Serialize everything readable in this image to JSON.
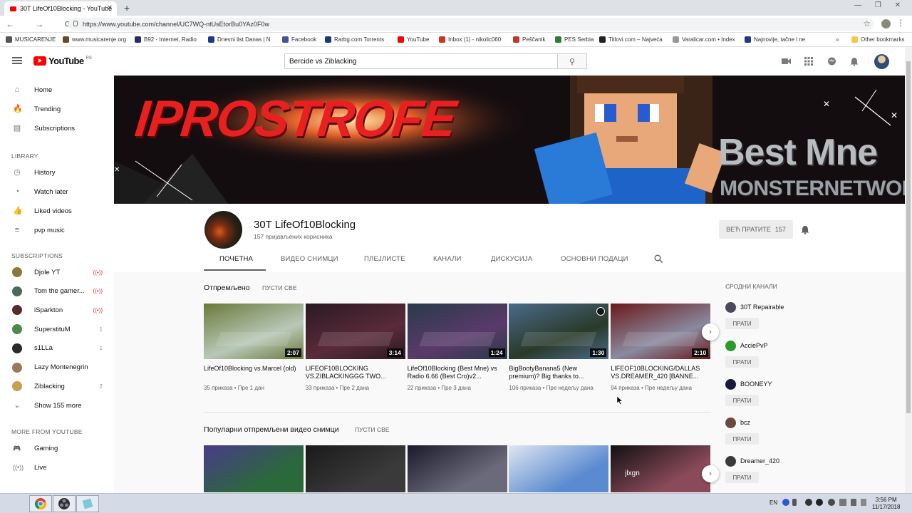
{
  "browser": {
    "tab_title": "30T LifeOf10Blocking - YouTube",
    "tab_close": "✕",
    "new_tab": "+",
    "window_controls": "— ❐ ✕",
    "nav": "← → ⟳ ⌂",
    "url": "https://www.youtube.com/channel/UC7WQ-ntUsEtorBu0YAz0F0w",
    "star": "☆",
    "menu": "⋮",
    "bookmarks": [
      {
        "label": "MUSICARENJE",
        "color": "#555555"
      },
      {
        "label": "www.musicarenje.org",
        "color": "#6b4a2a"
      },
      {
        "label": "B92 - Internet, Radio",
        "color": "#2a2a6b"
      },
      {
        "label": "Dnevni list Danas | N",
        "color": "#1a3a8a"
      },
      {
        "label": "Facebook",
        "color": "#3b5998"
      },
      {
        "label": "Rarbg.com Torrents",
        "color": "#1a3a7a"
      },
      {
        "label": "YouTube",
        "color": "#ff0000"
      },
      {
        "label": "Inbox (1) - nikolic060",
        "color": "#d93025"
      },
      {
        "label": "Peščanik",
        "color": "#c0392b"
      },
      {
        "label": "PES Serbia",
        "color": "#2e7d32"
      },
      {
        "label": "Titlovi.com – Najveća",
        "color": "#222222"
      },
      {
        "label": "Varalicar.com • Index",
        "color": "#999999"
      },
      {
        "label": "Najnovije, tačne i ne",
        "color": "#1b3a8a"
      }
    ],
    "bookmarks_more": "»",
    "other_bookmarks": "Other bookmarks"
  },
  "youtube": {
    "logo_text": "YouTube",
    "logo_region": "RS",
    "search_value": "Bercide vs Ziblacking",
    "search_icon": "⚲",
    "header_icons": [
      "camera-icon",
      "apps-icon",
      "messages-icon",
      "bell-icon"
    ],
    "sidebar": {
      "main": [
        {
          "label": "Home",
          "icon": "⌂"
        },
        {
          "label": "Trending",
          "icon": "🔥"
        },
        {
          "label": "Subscriptions",
          "icon": "▤"
        }
      ],
      "library_heading": "LIBRARY",
      "library": [
        {
          "label": "History",
          "icon": "◷"
        },
        {
          "label": "Watch later",
          "icon": "◔"
        },
        {
          "label": "Liked videos",
          "icon": "👍"
        },
        {
          "label": "pvp music",
          "icon": "≡"
        }
      ],
      "subscriptions_heading": "SUBSCRIPTIONS",
      "subscriptions": [
        {
          "label": "Djole YT",
          "badge": "((•))",
          "count": "",
          "color": "#8a7a3a"
        },
        {
          "label": "Tom the gamer...",
          "badge": "((•))",
          "count": "",
          "color": "#4a6a5a"
        },
        {
          "label": "iSparkton",
          "badge": "((•))",
          "count": "",
          "color": "#5a2a2a"
        },
        {
          "label": "SuperstituM",
          "badge": "",
          "count": "1",
          "color": "#4a8a4a"
        },
        {
          "label": "s1LLa",
          "badge": "",
          "count": "1",
          "color": "#2a2a2a"
        },
        {
          "label": "Lazy Montenegrin",
          "badge": "",
          "count": "",
          "color": "#9a7a5a"
        },
        {
          "label": "Ziblacking",
          "badge": "",
          "count": "2",
          "color": "#c8a050"
        }
      ],
      "show_more": "Show 155 more",
      "more_heading": "MORE FROM YOUTUBE",
      "more": [
        {
          "label": "Gaming",
          "icon": "🎮"
        },
        {
          "label": "Live",
          "icon": "((•))"
        }
      ]
    },
    "channel": {
      "name": "30T LifeOf10Blocking",
      "subs": "157 пријављених корисника",
      "subscribed_label": "ВЕЋ ПРАТИТЕ",
      "subscribed_count": "157",
      "tabs": [
        "ПОЧЕТНА",
        "ВИДЕО СНИМЦИ",
        "ПЛЕЈЛИСТЕ",
        "КАНАЛИ",
        "ДИСКУСИЈА",
        "ОСНОВНИ ПОДАЦИ"
      ],
      "banner_left": "IPROSTROFE",
      "banner_right_1": "Best Mne",
      "banner_right_2": "MONSTERNETWORK"
    },
    "uploads": {
      "title": "Отпремљено",
      "play_all": "ПУСТИ СВЕ",
      "videos": [
        {
          "title": "LifeOf10Blocking vs.Marcel (old)",
          "views": "35 приказа",
          "age": "Пре 1 дан",
          "duration": "2:07",
          "c1": "#6a7a3a",
          "c2": "#b8c8b8"
        },
        {
          "title": "LIFEOF10BLOCKING VS.ZIBLACKINGGG TWO...",
          "views": "33 приказа",
          "age": "Пре 2 дана",
          "duration": "3:14",
          "c1": "#2a1a22",
          "c2": "#5a2a3a"
        },
        {
          "title": "LifeOf10Blocking (Best Mne) vs Radio 6.66 (Best Cro)v2...",
          "views": "22 приказа",
          "age": "Пре 3 дана",
          "duration": "1:24",
          "c1": "#2a3a4a",
          "c2": "#5a3a6a"
        },
        {
          "title": "BigBootyBanana5 (New premium)? Big thanks to...",
          "views": "106 приказа",
          "age": "Пре недељу дана",
          "duration": "1:30",
          "c1": "#4a6a8a",
          "c2": "#2a3a2a"
        },
        {
          "title": "LIFEOF10BLOCKING/DALLAS VS.DREAMER_420 [BANNE...",
          "views": "94 приказа",
          "age": "Пре недељу дана",
          "duration": "2:10",
          "c1": "#6a1a1a",
          "c2": "#8a8aa0"
        }
      ]
    },
    "popular": {
      "title": "Популарни отпремљени видео снимци",
      "play_all": "ПУСТИ СВЕ",
      "thumbs": [
        {
          "c1": "#4a3a8a",
          "c2": "#2a6a3a"
        },
        {
          "c1": "#1a1a1a",
          "c2": "#3a3a3a"
        },
        {
          "c1": "#1a1a2a",
          "c2": "#6a6a7a"
        },
        {
          "c1": "#dfe6f0",
          "c2": "#5a8ad0"
        },
        {
          "c1": "#111111",
          "c2": "#8a4a5a"
        }
      ],
      "thumb_text": "jlxgn"
    },
    "related": {
      "heading": "СРОДНИ КАНАЛИ",
      "follow_label": "ПРАТИ",
      "channels": [
        {
          "name": "30T Repairable",
          "color": "#4a4a5a"
        },
        {
          "name": "AcciePvP",
          "color": "#2a9a2a"
        },
        {
          "name": "BOONEYY",
          "color": "#1a1a3a"
        },
        {
          "name": "bcz",
          "color": "#6a4a3a"
        },
        {
          "name": "Dreamer_420",
          "color": "#3a3a3a"
        }
      ]
    }
  },
  "taskbar": {
    "lang": "EN",
    "time": "3:56 PM",
    "date": "11/17/2018"
  }
}
